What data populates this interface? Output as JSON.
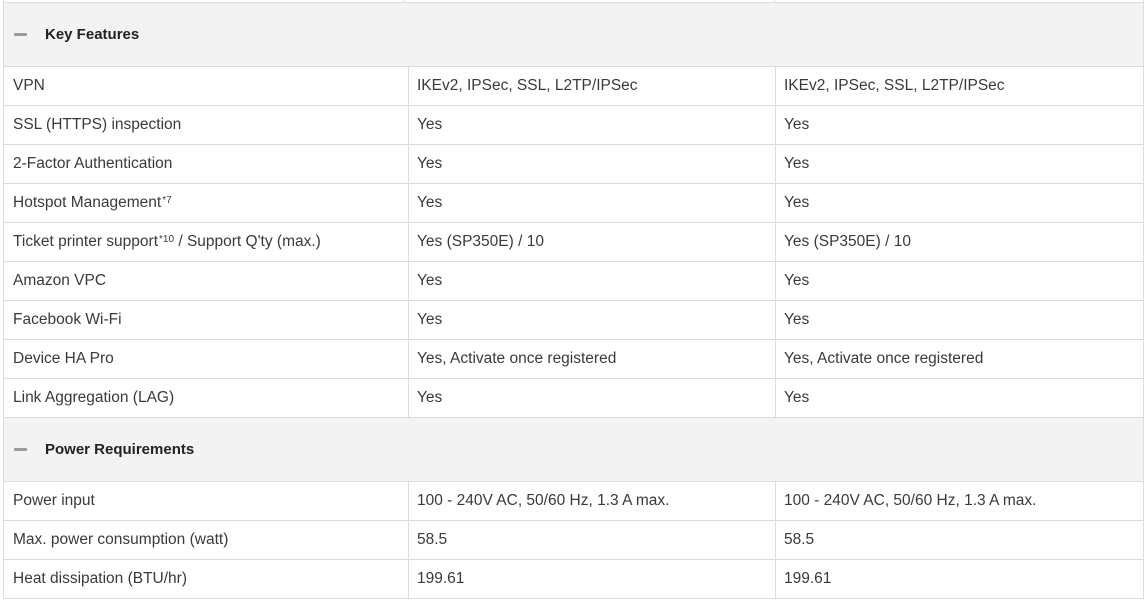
{
  "sections": [
    {
      "title": "Key Features",
      "rows": [
        {
          "label": "VPN",
          "sup": "",
          "suffix": "",
          "col1": "IKEv2, IPSec, SSL, L2TP/IPSec",
          "col2": "IKEv2, IPSec, SSL, L2TP/IPSec"
        },
        {
          "label": "SSL (HTTPS) inspection",
          "sup": "",
          "suffix": "",
          "col1": "Yes",
          "col2": "Yes"
        },
        {
          "label": "2-Factor Authentication",
          "sup": "",
          "suffix": "",
          "col1": "Yes",
          "col2": "Yes"
        },
        {
          "label": "Hotspot Management",
          "sup": "*7",
          "suffix": "",
          "col1": "Yes",
          "col2": "Yes"
        },
        {
          "label": "Ticket printer support",
          "sup": "*10",
          "suffix": " / Support Q'ty (max.)",
          "col1": "Yes (SP350E) / 10",
          "col2": "Yes (SP350E) / 10"
        },
        {
          "label": "Amazon VPC",
          "sup": "",
          "suffix": "",
          "col1": "Yes",
          "col2": "Yes"
        },
        {
          "label": "Facebook Wi-Fi",
          "sup": "",
          "suffix": "",
          "col1": "Yes",
          "col2": "Yes"
        },
        {
          "label": "Device HA Pro",
          "sup": "",
          "suffix": "",
          "col1": "Yes, Activate once registered",
          "col2": "Yes, Activate once registered"
        },
        {
          "label": "Link Aggregation (LAG)",
          "sup": "",
          "suffix": "",
          "col1": "Yes",
          "col2": "Yes"
        }
      ]
    },
    {
      "title": "Power Requirements",
      "rows": [
        {
          "label": "Power input",
          "sup": "",
          "suffix": "",
          "col1": "100 - 240V AC, 50/60 Hz, 1.3 A max.",
          "col2": "100 - 240V AC, 50/60 Hz, 1.3 A max."
        },
        {
          "label": "Max. power consumption (watt)",
          "sup": "",
          "suffix": "",
          "col1": "58.5",
          "col2": "58.5"
        },
        {
          "label": "Heat dissipation (BTU/hr)",
          "sup": "",
          "suffix": "",
          "col1": "199.61",
          "col2": "199.61"
        }
      ]
    }
  ],
  "icons": {
    "section_toggle": "collapse-minus-icon"
  },
  "colors": {
    "header_bg": "#f3f3f3",
    "border": "#dcdcdc",
    "toggle": "#9a9a9a"
  }
}
